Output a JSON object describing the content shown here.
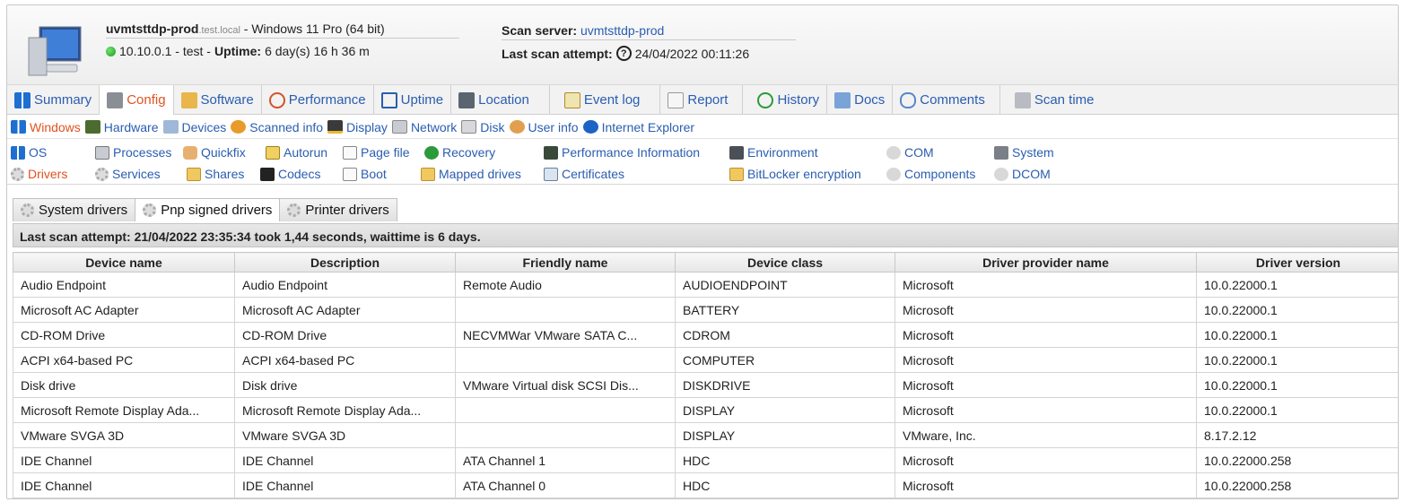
{
  "header": {
    "hostname": "uvmtsttdp-prod",
    "domain": ".test.local",
    "os": " - Windows 11 Pro (64 bit)",
    "ip_line": "10.10.0.1 - test - ",
    "uptime_label": "Uptime:",
    "uptime_value": " 6 day(s) 16 h 36 m",
    "scan_server_label": "Scan server: ",
    "scan_server_value": "uvmtsttdp-prod",
    "last_scan_label": "Last scan attempt:",
    "last_scan_value": "24/04/2022 00:11:26"
  },
  "main_tabs": [
    "Summary",
    "Config",
    "Software",
    "Performance",
    "Uptime",
    "Location",
    "Event log",
    "Report",
    "History",
    "Docs",
    "Comments",
    "Scan time"
  ],
  "sub_tabs": [
    "Windows",
    "Hardware",
    "Devices",
    "Scanned info",
    "Display",
    "Network",
    "Disk",
    "User info",
    "Internet Explorer"
  ],
  "config_links": {
    "os": "OS",
    "processes": "Processes",
    "quickfix": "Quickfix",
    "autorun": "Autorun",
    "pagefile": "Page file",
    "recovery": "Recovery",
    "perfinfo": "Performance Information",
    "environment": "Environment",
    "com": "COM",
    "system": "System",
    "drivers": "Drivers",
    "services": "Services",
    "shares": "Shares",
    "codecs": "Codecs",
    "boot": "Boot",
    "mapped": "Mapped drives",
    "certificates": "Certificates",
    "bitlocker": "BitLocker encryption",
    "components": "Components",
    "dcom": "DCOM"
  },
  "driver_tabs": [
    "System drivers",
    "Pnp signed drivers",
    "Printer drivers"
  ],
  "scan_info": "Last scan attempt: 21/04/2022 23:35:34 took 1,44 seconds, waittime is 6 days.",
  "table": {
    "columns": [
      "Device name",
      "Description",
      "Friendly name",
      "Device class",
      "Driver provider name",
      "Driver version"
    ],
    "rows": [
      [
        "Audio Endpoint",
        "Audio Endpoint",
        "Remote Audio",
        "AUDIOENDPOINT",
        "Microsoft",
        "10.0.22000.1"
      ],
      [
        "Microsoft AC Adapter",
        "Microsoft AC Adapter",
        "",
        "BATTERY",
        "Microsoft",
        "10.0.22000.1"
      ],
      [
        "CD-ROM Drive",
        "CD-ROM Drive",
        "NECVMWar VMware SATA C...",
        "CDROM",
        "Microsoft",
        "10.0.22000.1"
      ],
      [
        "ACPI x64-based PC",
        "ACPI x64-based PC",
        "",
        "COMPUTER",
        "Microsoft",
        "10.0.22000.1"
      ],
      [
        "Disk drive",
        "Disk drive",
        "VMware Virtual disk SCSI Dis...",
        "DISKDRIVE",
        "Microsoft",
        "10.0.22000.1"
      ],
      [
        "Microsoft Remote Display Ada...",
        "Microsoft Remote Display Ada...",
        "",
        "DISPLAY",
        "Microsoft",
        "10.0.22000.1"
      ],
      [
        "VMware SVGA 3D",
        "VMware SVGA 3D",
        "",
        "DISPLAY",
        "VMware, Inc.",
        "8.17.2.12"
      ],
      [
        "IDE Channel",
        "IDE Channel",
        "ATA Channel 1",
        "HDC",
        "Microsoft",
        "10.0.22000.258"
      ],
      [
        "IDE Channel",
        "IDE Channel",
        "ATA Channel 0",
        "HDC",
        "Microsoft",
        "10.0.22000.258"
      ]
    ]
  }
}
